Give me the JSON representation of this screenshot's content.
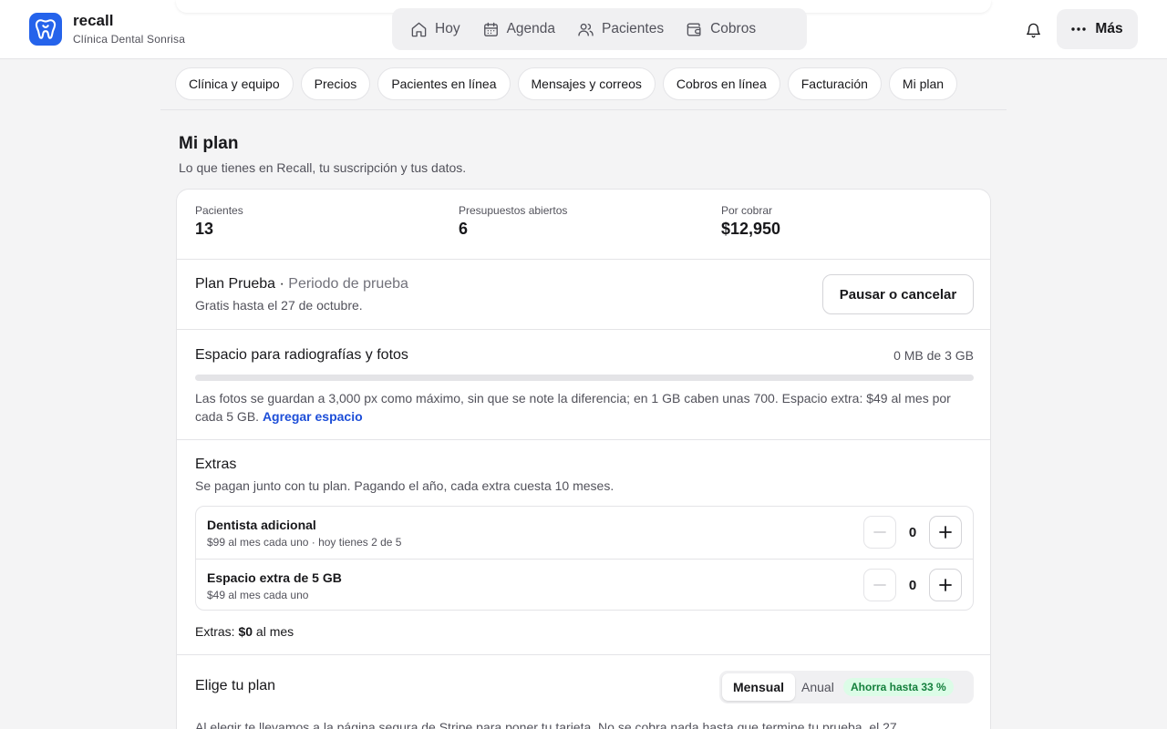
{
  "header": {
    "brand_name": "recall",
    "brand_sub": "Clínica Dental Sonrisa",
    "nav": [
      {
        "label": "Hoy",
        "icon": "home-icon"
      },
      {
        "label": "Agenda",
        "icon": "calendar-icon"
      },
      {
        "label": "Pacientes",
        "icon": "users-icon"
      },
      {
        "label": "Cobros",
        "icon": "wallet-icon"
      }
    ],
    "more_label": "Más"
  },
  "tabs": [
    "Clínica y equipo",
    "Precios",
    "Pacientes en línea",
    "Mensajes y correos",
    "Cobros en línea",
    "Facturación",
    "Mi plan"
  ],
  "page": {
    "title": "Mi plan",
    "subtitle": "Lo que tienes en Recall, tu suscripción y tus datos."
  },
  "stats": [
    {
      "label": "Pacientes",
      "value": "13"
    },
    {
      "label": "Presupuestos abiertos",
      "value": "6"
    },
    {
      "label": "Por cobrar",
      "value": "$12,950"
    }
  ],
  "plan": {
    "name": "Plan Prueba",
    "separator": " · ",
    "status": "Periodo de prueba",
    "description": "Gratis hasta el 27 de octubre.",
    "pause_button": "Pausar o cancelar"
  },
  "storage": {
    "title": "Espacio para radiografías y fotos",
    "usage": "0 MB de 3 GB",
    "used_fraction": 0,
    "note": "Las fotos se guardan a 3,000 px como máximo, sin que se note la diferencia; en 1 GB caben unas 700. Espacio extra: $49 al mes por cada 5 GB.",
    "link": "Agregar espacio"
  },
  "extras": {
    "title": "Extras",
    "subtitle": "Se pagan junto con tu plan. Pagando el año, cada extra cuesta 10 meses.",
    "items": [
      {
        "name": "Dentista adicional",
        "desc": "$99 al mes cada uno · hoy tienes 2 de 5",
        "qty": "0"
      },
      {
        "name": "Espacio extra de 5 GB",
        "desc": "$49 al mes cada uno",
        "qty": "0"
      }
    ],
    "total_prefix": "Extras: ",
    "total_amount": "$0",
    "total_suffix": " al mes"
  },
  "choose": {
    "title": "Elige tu plan",
    "monthly": "Mensual",
    "annual": "Anual",
    "badge": "Ahorra hasta 33 %",
    "note": "Al elegir te llevamos a la página segura de Stripe para poner tu tarjeta. No se cobra nada hasta que termine tu prueba, el 27"
  },
  "colors": {
    "accent": "#2563eb",
    "link": "#1d4ed8",
    "badge_bg": "#dcfce7",
    "badge_text": "#15803d"
  }
}
